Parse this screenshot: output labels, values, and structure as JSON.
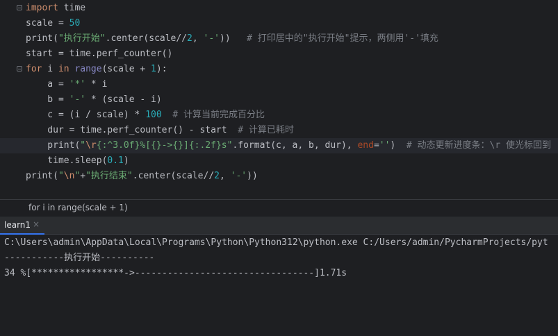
{
  "editor": {
    "lines": [
      {
        "parts": [
          {
            "t": "import",
            "c": "kw"
          },
          {
            "t": " time",
            "c": ""
          }
        ]
      },
      {
        "parts": [
          {
            "t": "scale = ",
            "c": ""
          },
          {
            "t": "50",
            "c": "num"
          }
        ]
      },
      {
        "parts": [
          {
            "t": "print",
            "c": "fn"
          },
          {
            "t": "(",
            "c": ""
          },
          {
            "t": "\"执行开始\"",
            "c": "str"
          },
          {
            "t": ".center(scale//",
            "c": ""
          },
          {
            "t": "2",
            "c": "num"
          },
          {
            "t": ", ",
            "c": ""
          },
          {
            "t": "'-'",
            "c": "str"
          },
          {
            "t": "))   ",
            "c": ""
          },
          {
            "t": "# 打印居中的\"执行开始\"提示，两侧用'-'填充",
            "c": "cmt"
          }
        ]
      },
      {
        "parts": [
          {
            "t": "start = time.perf_counter()",
            "c": ""
          }
        ]
      },
      {
        "parts": [
          {
            "t": "for",
            "c": "kw"
          },
          {
            "t": " i ",
            "c": ""
          },
          {
            "t": "in",
            "c": "kw"
          },
          {
            "t": " ",
            "c": ""
          },
          {
            "t": "range",
            "c": "builtin"
          },
          {
            "t": "(scale + ",
            "c": ""
          },
          {
            "t": "1",
            "c": "num"
          },
          {
            "t": "):",
            "c": ""
          }
        ]
      },
      {
        "parts": [
          {
            "t": "    a = ",
            "c": ""
          },
          {
            "t": "'*'",
            "c": "str"
          },
          {
            "t": " * i",
            "c": ""
          }
        ]
      },
      {
        "parts": [
          {
            "t": "    b = ",
            "c": ""
          },
          {
            "t": "'-'",
            "c": "str"
          },
          {
            "t": " * (scale - i)",
            "c": ""
          }
        ]
      },
      {
        "parts": [
          {
            "t": "    c = (i / scale) * ",
            "c": ""
          },
          {
            "t": "100",
            "c": "num"
          },
          {
            "t": "  ",
            "c": ""
          },
          {
            "t": "# 计算当前完成百分比",
            "c": "cmt"
          }
        ]
      },
      {
        "parts": [
          {
            "t": "    dur = time.perf_counter() - start  ",
            "c": ""
          },
          {
            "t": "# 计算已耗时",
            "c": "cmt"
          }
        ]
      },
      {
        "parts": [
          {
            "t": "    print",
            "c": "fn"
          },
          {
            "t": "(",
            "c": ""
          },
          {
            "t": "\"",
            "c": "str"
          },
          {
            "t": "\\r",
            "c": "esc"
          },
          {
            "t": "{:^3.0f}%[{}->{}]{:.2f}s\"",
            "c": "str"
          },
          {
            "t": ".format(c, a, b, dur), ",
            "c": ""
          },
          {
            "t": "end",
            "c": "kwarg"
          },
          {
            "t": "=",
            "c": ""
          },
          {
            "t": "''",
            "c": "str"
          },
          {
            "t": ")  ",
            "c": ""
          },
          {
            "t": "# 动态更新进度条：\\r 使光标回到",
            "c": "cmt"
          }
        ]
      },
      {
        "parts": [
          {
            "t": "    time.sleep(",
            "c": ""
          },
          {
            "t": "0.1",
            "c": "num"
          },
          {
            "t": ")",
            "c": ""
          }
        ]
      },
      {
        "parts": [
          {
            "t": "print",
            "c": "fn"
          },
          {
            "t": "(",
            "c": ""
          },
          {
            "t": "\"",
            "c": "str"
          },
          {
            "t": "\\n",
            "c": "esc"
          },
          {
            "t": "\"",
            "c": "str"
          },
          {
            "t": "+",
            "c": ""
          },
          {
            "t": "\"执行结束\"",
            "c": "str"
          },
          {
            "t": ".center(scale//",
            "c": ""
          },
          {
            "t": "2",
            "c": "num"
          },
          {
            "t": ", ",
            "c": ""
          },
          {
            "t": "'-'",
            "c": "str"
          },
          {
            "t": "))",
            "c": ""
          }
        ]
      }
    ],
    "current_line_index": 9
  },
  "breadcrumb": {
    "text": "for i in range(scale + 1)"
  },
  "run_panel": {
    "tab_label": "learn1",
    "close_glyph": "×",
    "console_lines": [
      "C:\\Users\\admin\\AppData\\Local\\Programs\\Python\\Python312\\python.exe C:/Users/admin/PycharmProjects/pyt",
      "-----------执行开始----------",
      "34 %[*****************->---------------------------------]1.71s"
    ]
  },
  "colors": {
    "editor_bg": "#1e1f22",
    "keyword": "#cf8e6d",
    "string": "#6aab73",
    "number": "#2aacb8",
    "comment": "#7a7e85",
    "tab_underline": "#3574f0"
  }
}
